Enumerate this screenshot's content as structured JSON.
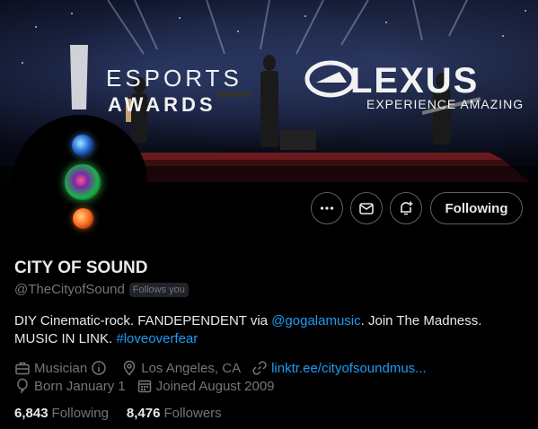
{
  "banner": {
    "esports_line1": "ESPORTS",
    "esports_line2": "AWARDS",
    "lexus_word": "LEXUS",
    "lexus_tagline": "EXPERIENCE AMAZING"
  },
  "actions": {
    "more_icon": "more-horizontal-icon",
    "message_icon": "envelope-icon",
    "notify_icon": "bell-plus-icon",
    "follow_label": "Following"
  },
  "profile": {
    "name": "CITY OF SOUND",
    "handle": "@TheCityofSound",
    "follows_you": "Follows you",
    "bio_part1": "DIY Cinematic-rock. FANDEPENDENT via ",
    "bio_mention": "@gogalamusic",
    "bio_part2": ". Join The Madness. MUSIC IN LINK. ",
    "bio_hashtag": "#loveoverfear",
    "category": "Musician",
    "location": "Los Angeles, CA",
    "website": "linktr.ee/cityofsoundmus...",
    "birthday": "Born January 1",
    "joined": "Joined August 2009"
  },
  "stats": {
    "following_count": "6,843",
    "following_label": "Following",
    "followers_count": "8,476",
    "followers_label": "Followers"
  },
  "colors": {
    "background": "#000000",
    "text_primary": "#e7e9ea",
    "text_secondary": "#71767b",
    "link": "#1d9bf0",
    "border": "#536471"
  }
}
